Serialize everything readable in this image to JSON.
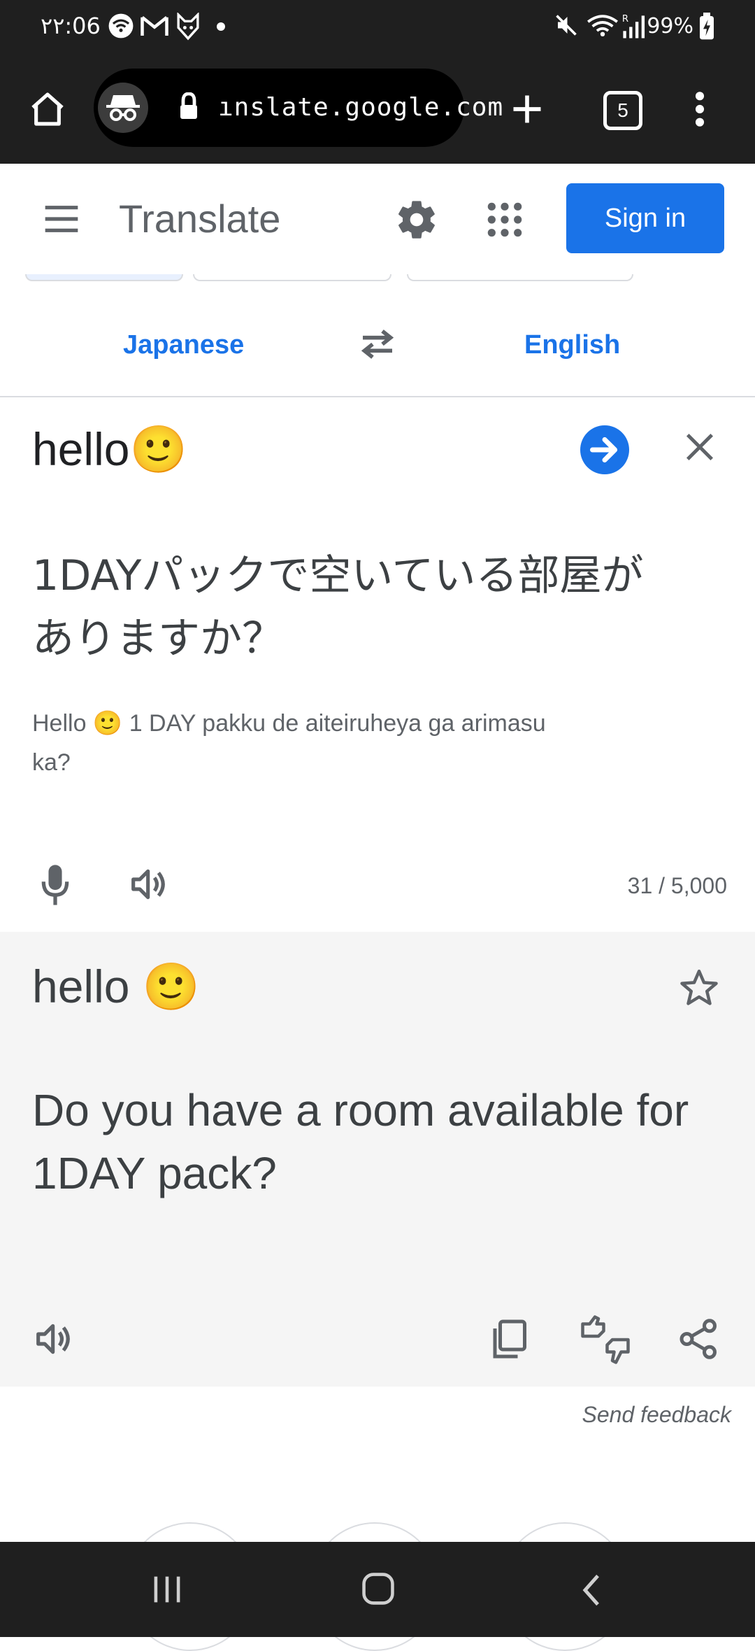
{
  "status_bar": {
    "time": "٢٢:06",
    "battery": "99%",
    "icons": [
      "wifi-icon",
      "gmail-icon",
      "fox-mask-icon",
      "dot-icon",
      "mute-icon",
      "wifi-signal-icon",
      "cell-signal-icon",
      "battery-icon"
    ]
  },
  "browser": {
    "url": "ınslate.google.com",
    "tab_count": "5",
    "icons": [
      "home-icon",
      "incognito-icon",
      "lock-icon",
      "new-tab-icon",
      "tabs-icon",
      "more-icon"
    ]
  },
  "app": {
    "title": "Translate",
    "sign_in": "Sign in"
  },
  "languages": {
    "source": "Japanese",
    "target": "English"
  },
  "source": {
    "input": "hello🙂",
    "japanese": "1DAYパックで空いている部屋がありますか？",
    "romanization": "Hello 🙂 1 DAY pakku de aiteiruheya ga arimasu ka?",
    "char_count": "31 / 5,000"
  },
  "output": {
    "input_echo": "hello 🙂",
    "translation": "Do you have a room available for 1DAY pack?"
  },
  "feedback": "Send feedback",
  "colors": {
    "accent": "#1a73e8",
    "dark_bar": "#1f1f1f",
    "output_bg": "#f5f5f5"
  }
}
